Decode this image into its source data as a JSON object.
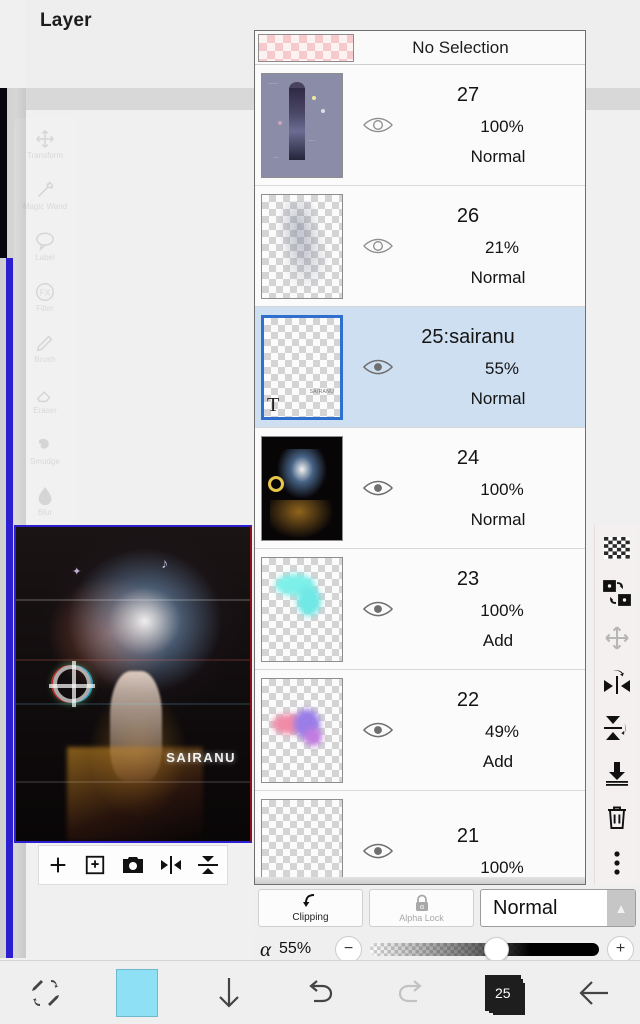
{
  "header": {
    "title": "Layer"
  },
  "tool_palette": {
    "items": [
      {
        "label": "Transform",
        "icon": "move-arrows-icon"
      },
      {
        "label": "Magic Wand",
        "icon": "magic-wand-icon"
      },
      {
        "label": "Label",
        "icon": "speech-bubble-icon"
      },
      {
        "label": "Filter",
        "icon": "fx-icon"
      },
      {
        "label": "Brush",
        "icon": "brush-icon"
      },
      {
        "label": "Eraser",
        "icon": "eraser-icon"
      },
      {
        "label": "Smudge",
        "icon": "smudge-icon"
      },
      {
        "label": "Blur",
        "icon": "droplet-icon"
      }
    ]
  },
  "canvas": {
    "signature": "SAIRANU",
    "actions": [
      {
        "name": "add-layer",
        "icon": "plus-icon"
      },
      {
        "name": "add-image-layer",
        "icon": "add-frame-icon"
      },
      {
        "name": "camera",
        "icon": "camera-icon"
      },
      {
        "name": "flip-horizontal",
        "icon": "flip-horizontal-icon"
      },
      {
        "name": "flip-vertical",
        "icon": "flip-vertical-icon"
      }
    ]
  },
  "layer_panel": {
    "selection_status": "No Selection",
    "layers": [
      {
        "name": "27",
        "opacity": "100%",
        "blend": "Normal",
        "visible": false,
        "selected": false,
        "thumb": "character-sheet"
      },
      {
        "name": "26",
        "opacity": "21%",
        "blend": "Normal",
        "visible": false,
        "selected": false,
        "thumb": "sketch"
      },
      {
        "name": "25:sairanu",
        "opacity": "55%",
        "blend": "Normal",
        "visible": true,
        "selected": true,
        "thumb": "text",
        "text_marker": "T",
        "mini_text": "SAIRANU"
      },
      {
        "name": "24",
        "opacity": "100%",
        "blend": "Normal",
        "visible": true,
        "selected": false,
        "thumb": "artwork"
      },
      {
        "name": "23",
        "opacity": "100%",
        "blend": "Add",
        "visible": true,
        "selected": false,
        "thumb": "cyan-glow"
      },
      {
        "name": "22",
        "opacity": "49%",
        "blend": "Add",
        "visible": true,
        "selected": false,
        "thumb": "pink-glow"
      },
      {
        "name": "21",
        "opacity": "100%",
        "blend": "",
        "visible": true,
        "selected": false,
        "thumb": "empty"
      }
    ]
  },
  "right_toolbar": {
    "items": [
      {
        "name": "checkerboard-icon",
        "disabled": false
      },
      {
        "name": "swap-layer-icon",
        "disabled": false
      },
      {
        "name": "move-arrows-icon",
        "disabled": true
      },
      {
        "name": "flip-horizontal-icon",
        "disabled": false
      },
      {
        "name": "flip-vertical-icon",
        "disabled": false
      },
      {
        "name": "merge-down-icon",
        "disabled": false
      },
      {
        "name": "trash-icon",
        "disabled": false
      },
      {
        "name": "more-options-icon",
        "disabled": false
      }
    ]
  },
  "mode_bar": {
    "clipping_label": "Clipping",
    "alpha_lock_label": "Alpha Lock",
    "blend_mode": "Normal"
  },
  "alpha_bar": {
    "symbol": "α",
    "value": "55%",
    "minus": "−",
    "plus": "+",
    "percent": 55
  },
  "bottom_nav": {
    "items": [
      {
        "name": "brush-eraser-swap-icon",
        "disabled": false
      },
      {
        "name": "color-swatch",
        "color": "#8ee0f5",
        "disabled": false
      },
      {
        "name": "download-arrow-icon",
        "disabled": false
      },
      {
        "name": "undo-icon",
        "disabled": false
      },
      {
        "name": "redo-icon",
        "disabled": true
      },
      {
        "name": "layers-badge",
        "label": "25",
        "disabled": false
      },
      {
        "name": "back-arrow-icon",
        "disabled": false
      }
    ]
  }
}
